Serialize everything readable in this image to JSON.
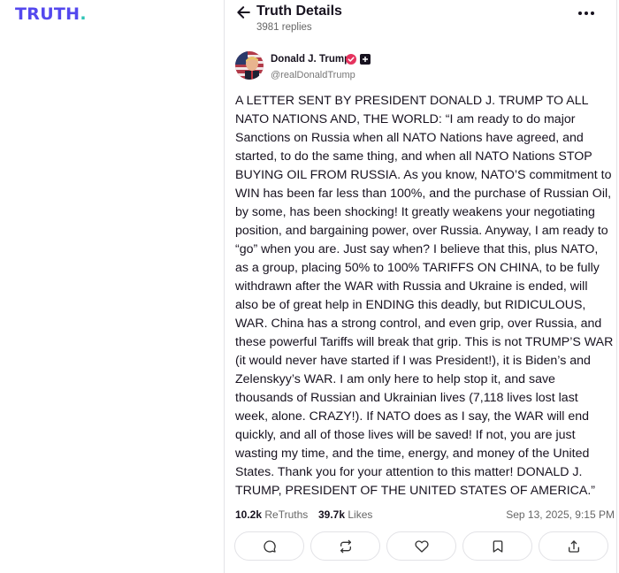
{
  "brand": {
    "logo_main": "TRUTH",
    "logo_dot": "."
  },
  "header": {
    "title": "Truth Details",
    "replies": "3981 replies",
    "back_icon": "arrow-left-icon",
    "more_icon": "more-horizontal-icon"
  },
  "author": {
    "name": "Donald J. Trump",
    "handle": "@realDonaldTrump",
    "verified_color": "#e5335e"
  },
  "post": {
    "text": "A LETTER SENT BY PRESIDENT DONALD J. TRUMP TO ALL NATO NATIONS AND, THE WORLD: “I am ready to do major Sanctions on Russia when all NATO Nations have agreed, and started, to do the same thing, and when all NATO Nations STOP BUYING OIL FROM RUSSIA. As you know, NATO’S commitment to WIN has been far less than 100%, and the purchase of Russian Oil, by some, has been shocking! It greatly weakens your negotiating position, and bargaining power, over Russia. Anyway, I am ready to “go” when you are. Just say when? I believe that this, plus NATO, as a group, placing 50% to 100% TARIFFS ON CHINA, to be fully withdrawn after the WAR with Russia and Ukraine is ended, will also be of great help in ENDING this deadly, but RIDICULOUS, WAR. China has a strong control, and even grip, over Russia, and these powerful Tariffs will break that grip. This is not TRUMP’S WAR (it would never have started if I was President!), it is Biden’s and Zelenskyy’s WAR. I am only here to help stop it, and save thousands of Russian and Ukrainian lives (7,118 lives lost last week, alone. CRAZY!). If NATO does as I say, the WAR will end quickly, and all of those lives will be saved! If not, you are just wasting my time, and the time, energy, and money of the United States. Thank you for your attention to this matter! DONALD J. TRUMP, PRESIDENT OF THE UNITED STATES OF AMERICA.”"
  },
  "stats": {
    "retruths_count": "10.2k",
    "retruths_label": "ReTruths",
    "likes_count": "39.7k",
    "likes_label": "Likes",
    "timestamp": "Sep 13, 2025, 9:15 PM"
  },
  "actions": [
    {
      "icon": "comment-icon"
    },
    {
      "icon": "retruth-icon"
    },
    {
      "icon": "heart-icon"
    },
    {
      "icon": "bookmark-icon"
    },
    {
      "icon": "share-icon"
    }
  ]
}
